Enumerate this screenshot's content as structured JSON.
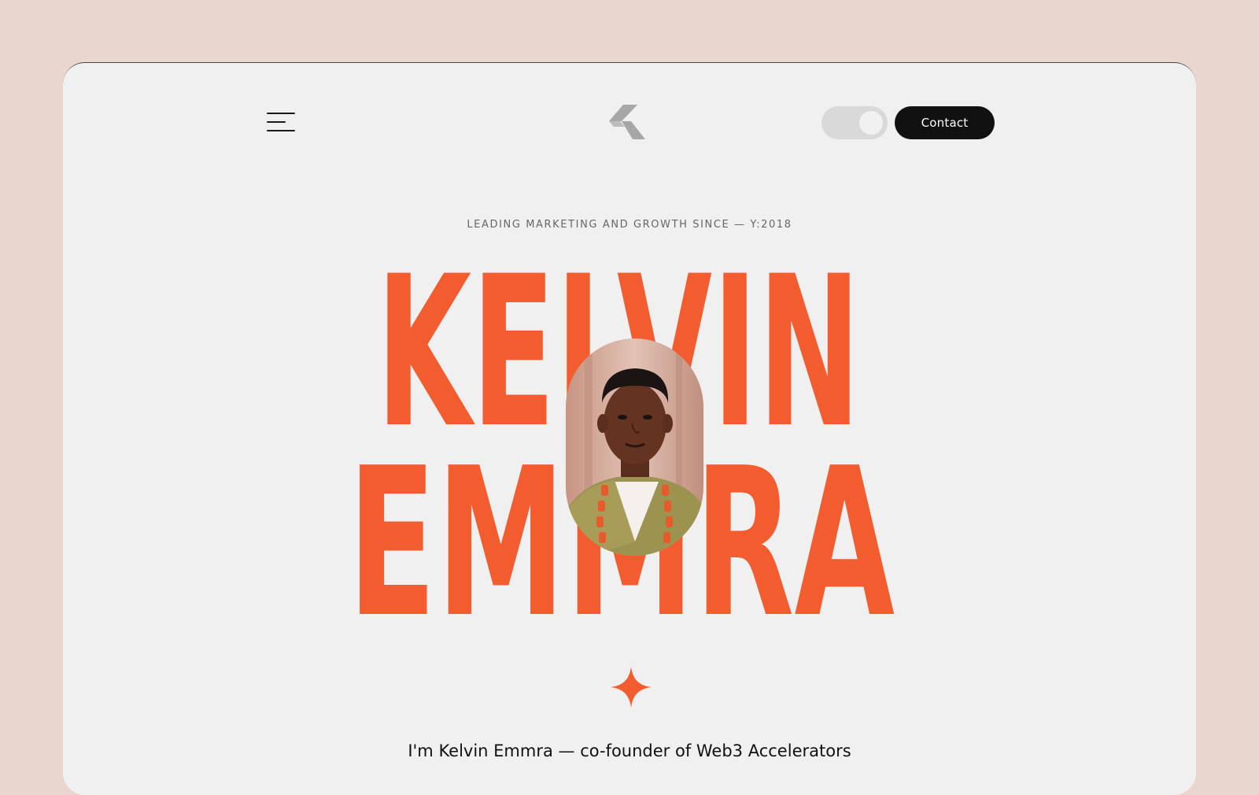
{
  "header": {
    "menu_icon": "hamburger-menu-icon",
    "logo_icon": "k-logo-icon",
    "theme_toggle": {
      "icon": "toggle-switch-icon",
      "state": "on"
    },
    "contact_label": "Contact"
  },
  "hero": {
    "tagline": "LEADING MARKETING AND GROWTH SINCE — Y:2018",
    "first_name": "KELVIN",
    "last_name": "EMMRA",
    "portrait_icon": "portrait-photo",
    "sparkle_icon": "four-point-star-icon",
    "intro": "I'm Kelvin Emmra — co-founder of Web3 Accelerators"
  },
  "colors": {
    "background": "#e8d6cf",
    "card": "#f0f0f0",
    "accent": "#f25c2f",
    "button": "#111111",
    "toggle_track": "#d9d9d9"
  }
}
